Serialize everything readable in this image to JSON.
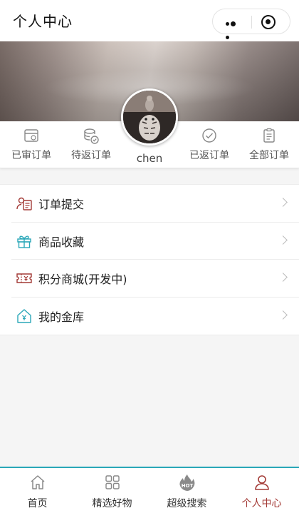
{
  "navbar": {
    "title": "个人中心"
  },
  "profile": {
    "username": "chen"
  },
  "orders": [
    {
      "label": "已审订单",
      "icon": "calendar-icon"
    },
    {
      "label": "待返订单",
      "icon": "coins-icon"
    },
    {
      "label": "已返订单",
      "icon": "check-circle-icon"
    },
    {
      "label": "全部订单",
      "icon": "clipboard-icon"
    }
  ],
  "menu": [
    {
      "label": "订单提交",
      "icon": "user-card-icon",
      "color": "#a33a36"
    },
    {
      "label": "商品收藏",
      "icon": "gift-icon",
      "color": "#2aa7b8"
    },
    {
      "label": "积分商城(开发中)",
      "icon": "ticket-icon",
      "color": "#a33a36"
    },
    {
      "label": "我的金库",
      "icon": "house-yen-icon",
      "color": "#2aa7b8"
    }
  ],
  "tabs": [
    {
      "label": "首页",
      "icon": "home-icon"
    },
    {
      "label": "精选好物",
      "icon": "grid-icon"
    },
    {
      "label": "超级搜索",
      "icon": "hot-icon",
      "badge": "HOT"
    },
    {
      "label": "个人中心",
      "icon": "person-icon",
      "active": true
    }
  ],
  "colors": {
    "accent": "#a33a36",
    "teal": "#2aa7b8",
    "icon_gray": "#888888"
  }
}
